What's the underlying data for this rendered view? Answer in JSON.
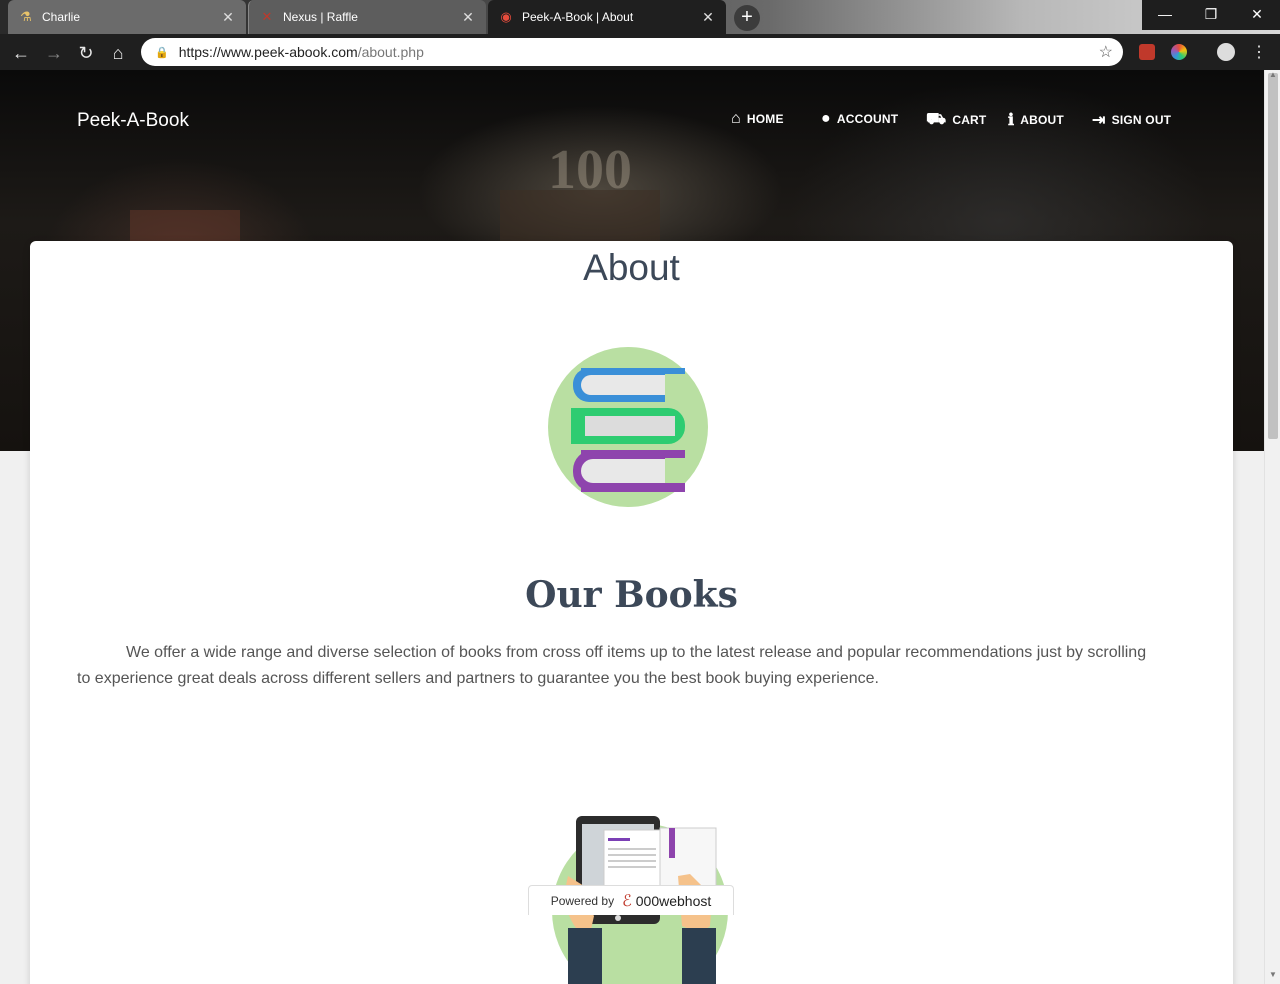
{
  "browser": {
    "tabs": [
      {
        "title": "Charlie",
        "favicon": "flask-icon",
        "active": false
      },
      {
        "title": "Nexus | Raffle",
        "favicon": "cross-icon",
        "active": false
      },
      {
        "title": "Peek-A-Book | About",
        "favicon": "lips-icon",
        "active": true
      }
    ],
    "new_tab_label": "+",
    "url_host": "https://www.peek-abook.com",
    "url_path": "/about.php",
    "window_controls": {
      "minimize": "—",
      "restore": "❐",
      "close": "✕"
    }
  },
  "site": {
    "brand": "Peek-A-Book",
    "nav": [
      {
        "label": "HOME",
        "icon": "home-icon",
        "glyph": "⌂"
      },
      {
        "label": "ACCOUNT",
        "icon": "user-icon",
        "glyph": "👤"
      },
      {
        "label": "CART",
        "icon": "cart-icon",
        "glyph": "🛒"
      },
      {
        "label": "ABOUT",
        "icon": "info-icon",
        "glyph": "ℹ"
      },
      {
        "label": "SIGN OUT",
        "icon": "sign-out-icon",
        "glyph": "⇥"
      }
    ]
  },
  "content": {
    "title": "About",
    "heading": "Our Books",
    "paragraph": "We offer a wide range and diverse selection of books from cross off items up to the latest release and popular recommendations just by scrolling to experience great deals across different sellers and partners to guarantee you the best book buying experience."
  },
  "footer_badge": {
    "prefix": "Powered by",
    "brand": "000webhost"
  },
  "colors": {
    "text_dark": "#3c4858",
    "illustration_green": "#b9dfa2",
    "book_blue": "#3a8fd8",
    "book_green": "#2ecc71",
    "book_purple": "#8e44ad"
  }
}
